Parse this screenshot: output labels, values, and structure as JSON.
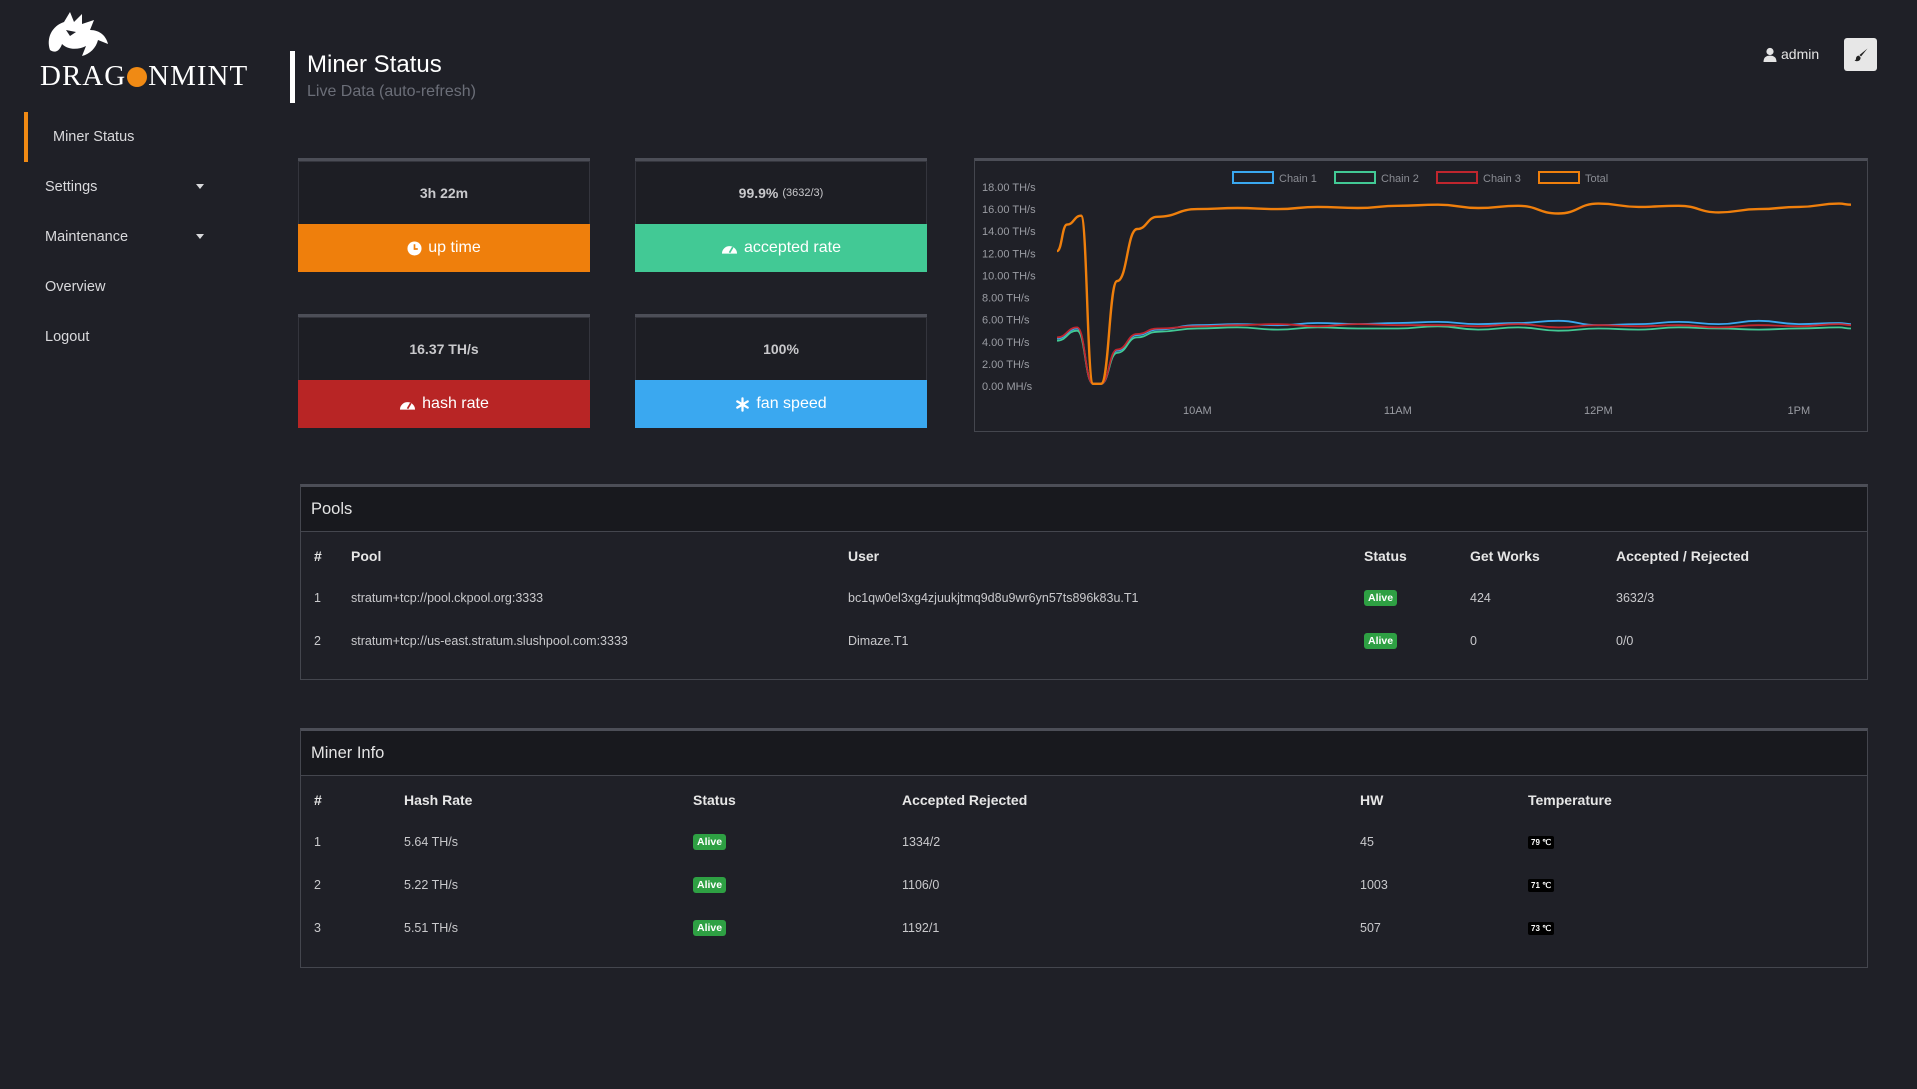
{
  "brand": {
    "name_left": "DRAG",
    "name_right": "NMINT"
  },
  "sidebar": {
    "items": [
      {
        "label": "Miner Status"
      },
      {
        "label": "Settings"
      },
      {
        "label": "Maintenance"
      },
      {
        "label": "Overview"
      },
      {
        "label": "Logout"
      }
    ]
  },
  "header": {
    "title": "Miner Status",
    "subtitle": "Live Data (auto-refresh)"
  },
  "user": {
    "name": "admin"
  },
  "colors": {
    "accent": "#f08a14",
    "uptime": "#ef7f0c",
    "accepted": "#42c995",
    "hashrate": "#b82525",
    "fan": "#3aa8f0",
    "badge": "#2ea043"
  },
  "stats": {
    "uptime": {
      "value": "3h 22m",
      "label": "up time",
      "icon": "clock-icon"
    },
    "accepted": {
      "value": "99.9%",
      "detail": "(3632/3)",
      "label": "accepted rate",
      "icon": "gauge-icon"
    },
    "hashrate": {
      "value": "16.37 TH/s",
      "label": "hash rate",
      "icon": "gauge-icon"
    },
    "fan": {
      "value": "100%",
      "label": "fan speed",
      "icon": "asterisk-icon"
    }
  },
  "chart_data": {
    "type": "line",
    "legend_position": "top",
    "y_ticks": [
      "0.00 MH/s",
      "2.00 TH/s",
      "4.00 TH/s",
      "6.00 TH/s",
      "8.00 TH/s",
      "10.00 TH/s",
      "12.00 TH/s",
      "14.00 TH/s",
      "16.00 TH/s",
      "18.00 TH/s"
    ],
    "ylim": [
      0,
      18
    ],
    "x_ticks": [
      "10AM",
      "11AM",
      "12PM",
      "1PM"
    ],
    "x_tick_hours": [
      10,
      11,
      12,
      13
    ],
    "xlim": [
      9.3,
      13.26
    ],
    "grid": false,
    "series": [
      {
        "name": "Chain 1",
        "color": "#3aa8f0",
        "x": [
          9.3,
          9.4,
          9.48,
          9.52,
          9.6,
          9.7,
          9.8,
          10.0,
          10.2,
          10.4,
          10.6,
          10.8,
          11.0,
          11.2,
          11.4,
          11.6,
          11.8,
          12.0,
          12.2,
          12.4,
          12.6,
          12.8,
          13.0,
          13.2,
          13.26
        ],
        "y": [
          4.3,
          5.2,
          0.2,
          0.2,
          3.2,
          4.6,
          5.1,
          5.5,
          5.6,
          5.5,
          5.7,
          5.6,
          5.7,
          5.8,
          5.6,
          5.7,
          5.9,
          5.5,
          5.6,
          5.8,
          5.6,
          5.9,
          5.6,
          5.7,
          5.6
        ]
      },
      {
        "name": "Chain 2",
        "color": "#42c995",
        "x": [
          9.3,
          9.4,
          9.48,
          9.52,
          9.6,
          9.7,
          9.8,
          10.0,
          10.2,
          10.4,
          10.6,
          10.8,
          11.0,
          11.2,
          11.4,
          11.6,
          11.8,
          12.0,
          12.2,
          12.4,
          12.6,
          12.8,
          13.0,
          13.2,
          13.26
        ],
        "y": [
          4.1,
          5.0,
          0.2,
          0.2,
          3.0,
          4.4,
          4.9,
          5.2,
          5.3,
          5.1,
          5.3,
          5.2,
          5.2,
          5.4,
          5.1,
          5.3,
          5.0,
          5.2,
          5.1,
          5.3,
          5.2,
          5.1,
          5.2,
          5.3,
          5.2
        ]
      },
      {
        "name": "Chain 3",
        "color": "#c0262e",
        "x": [
          9.3,
          9.4,
          9.48,
          9.52,
          9.6,
          9.7,
          9.8,
          10.0,
          10.2,
          10.4,
          10.6,
          10.8,
          11.0,
          11.2,
          11.4,
          11.6,
          11.8,
          12.0,
          12.2,
          12.4,
          12.6,
          12.8,
          13.0,
          13.2,
          13.26
        ],
        "y": [
          4.4,
          5.3,
          0.2,
          0.2,
          3.3,
          4.7,
          5.2,
          5.4,
          5.5,
          5.6,
          5.4,
          5.6,
          5.5,
          5.5,
          5.4,
          5.6,
          5.3,
          5.5,
          5.4,
          5.5,
          5.3,
          5.5,
          5.4,
          5.6,
          5.5
        ]
      },
      {
        "name": "Total",
        "color": "#ef7f0c",
        "x": [
          9.3,
          9.35,
          9.42,
          9.48,
          9.52,
          9.6,
          9.7,
          9.8,
          10.0,
          10.2,
          10.4,
          10.6,
          10.8,
          11.0,
          11.2,
          11.4,
          11.6,
          11.8,
          12.0,
          12.2,
          12.4,
          12.6,
          12.8,
          13.0,
          13.2,
          13.26
        ],
        "y": [
          12.2,
          14.6,
          15.4,
          0.2,
          0.2,
          9.5,
          14.2,
          15.3,
          16.0,
          16.1,
          16.0,
          16.2,
          16.1,
          16.3,
          16.4,
          16.1,
          16.3,
          15.6,
          16.5,
          16.2,
          16.3,
          15.7,
          16.0,
          16.2,
          16.5,
          16.4
        ]
      }
    ]
  },
  "pools": {
    "title": "Pools",
    "columns": [
      "#",
      "Pool",
      "User",
      "Status",
      "Get Works",
      "Accepted / Rejected"
    ],
    "rows": [
      {
        "n": "1",
        "pool": "stratum+tcp://pool.ckpool.org:3333",
        "user": "bc1qw0el3xg4zjuukjtmq9d8u9wr6yn57ts896k83u.T1",
        "status": "Alive",
        "works": "424",
        "ar": "3632/3"
      },
      {
        "n": "2",
        "pool": "stratum+tcp://us-east.stratum.slushpool.com:3333",
        "user": "Dimaze.T1",
        "status": "Alive",
        "works": "0",
        "ar": "0/0"
      }
    ]
  },
  "miner_info": {
    "title": "Miner Info",
    "columns": [
      "#",
      "Hash Rate",
      "Status",
      "Accepted Rejected",
      "HW",
      "Temperature"
    ],
    "rows": [
      {
        "n": "1",
        "rate": "5.64 TH/s",
        "status": "Alive",
        "ar": "1334/2",
        "hw": "45",
        "temp": "79 ℃"
      },
      {
        "n": "2",
        "rate": "5.22 TH/s",
        "status": "Alive",
        "ar": "1106/0",
        "hw": "1003",
        "temp": "71 ℃"
      },
      {
        "n": "3",
        "rate": "5.51 TH/s",
        "status": "Alive",
        "ar": "1192/1",
        "hw": "507",
        "temp": "73 ℃"
      }
    ]
  }
}
